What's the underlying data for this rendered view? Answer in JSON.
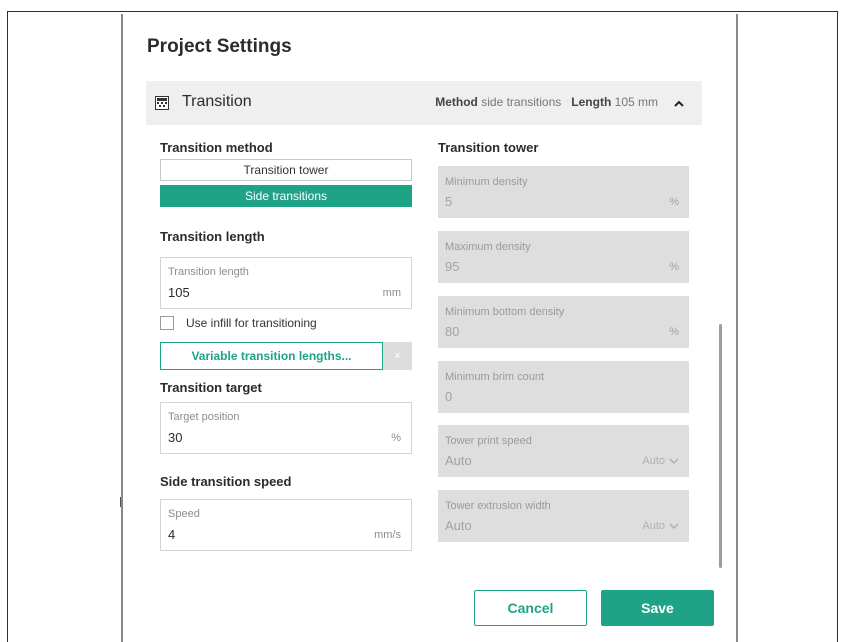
{
  "dialog": {
    "title": "Project Settings"
  },
  "section": {
    "icon": "transition-grid-icon",
    "title": "Transition",
    "summary_method_label": "Method",
    "summary_method_value": "side transitions",
    "summary_length_label": "Length",
    "summary_length_value": "105 mm",
    "collapse_icon": "chevron-up-icon"
  },
  "left": {
    "transition_method": {
      "heading": "Transition method",
      "options": [
        "Transition tower",
        "Side transitions"
      ],
      "selected": "Side transitions"
    },
    "transition_length": {
      "heading": "Transition length",
      "field_label": "Transition length",
      "value": "105",
      "unit": "mm"
    },
    "use_infill": {
      "label": "Use infill for transitioning",
      "checked": false
    },
    "variable_lengths_button": "Variable transition lengths...",
    "clear_button": "×",
    "transition_target": {
      "heading": "Transition target",
      "field_label": "Target position",
      "value": "30",
      "unit": "%"
    },
    "side_transition_speed": {
      "heading": "Side transition speed",
      "field_label": "Speed",
      "value": "4",
      "unit": "mm/s"
    }
  },
  "right": {
    "heading": "Transition tower",
    "fields": [
      {
        "label": "Minimum density",
        "value": "5",
        "unit": "%"
      },
      {
        "label": "Maximum density",
        "value": "95",
        "unit": "%"
      },
      {
        "label": "Minimum bottom density",
        "value": "80",
        "unit": "%"
      },
      {
        "label": "Minimum brim count",
        "value": "0",
        "unit": ""
      },
      {
        "label": "Tower print speed",
        "value": "Auto",
        "dropdown": "Auto"
      },
      {
        "label": "Tower extrusion width",
        "value": "Auto",
        "dropdown": "Auto"
      }
    ]
  },
  "footer": {
    "cancel": "Cancel",
    "save": "Save"
  },
  "colors": {
    "accent": "#1fa386",
    "disabled_bg": "#dedede",
    "section_bg": "#efefef"
  }
}
